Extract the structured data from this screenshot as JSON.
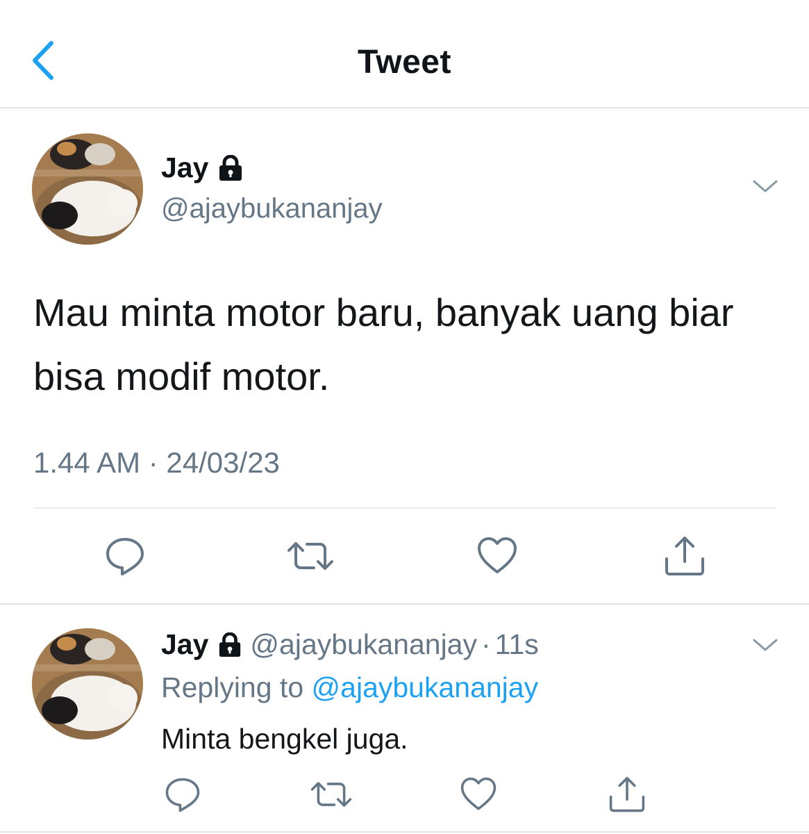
{
  "header": {
    "title": "Tweet",
    "back_icon": "chevron-left-icon"
  },
  "colors": {
    "accent": "#1da1f2",
    "secondary_text": "#657786",
    "primary_text": "#14171a",
    "divider": "#dfe3e6"
  },
  "main_tweet": {
    "author_name": "Jay",
    "author_handle": "@ajaybukananjay",
    "protected_icon": "lock-icon",
    "text": "Mau minta motor baru, banyak uang biar bisa modif motor.",
    "timestamp": "1.44 AM · 24/03/23",
    "actions": [
      "reply-icon",
      "retweet-icon",
      "like-icon",
      "share-icon"
    ]
  },
  "reply_tweet": {
    "author_name": "Jay",
    "author_handle": "@ajaybukananjay",
    "separator": "·",
    "time_ago": "11s",
    "replying_label": "Replying to",
    "replying_to": "@ajaybukananjay",
    "text": "Minta bengkel juga.",
    "actions": [
      "reply-icon",
      "retweet-icon",
      "like-icon",
      "share-icon"
    ]
  }
}
